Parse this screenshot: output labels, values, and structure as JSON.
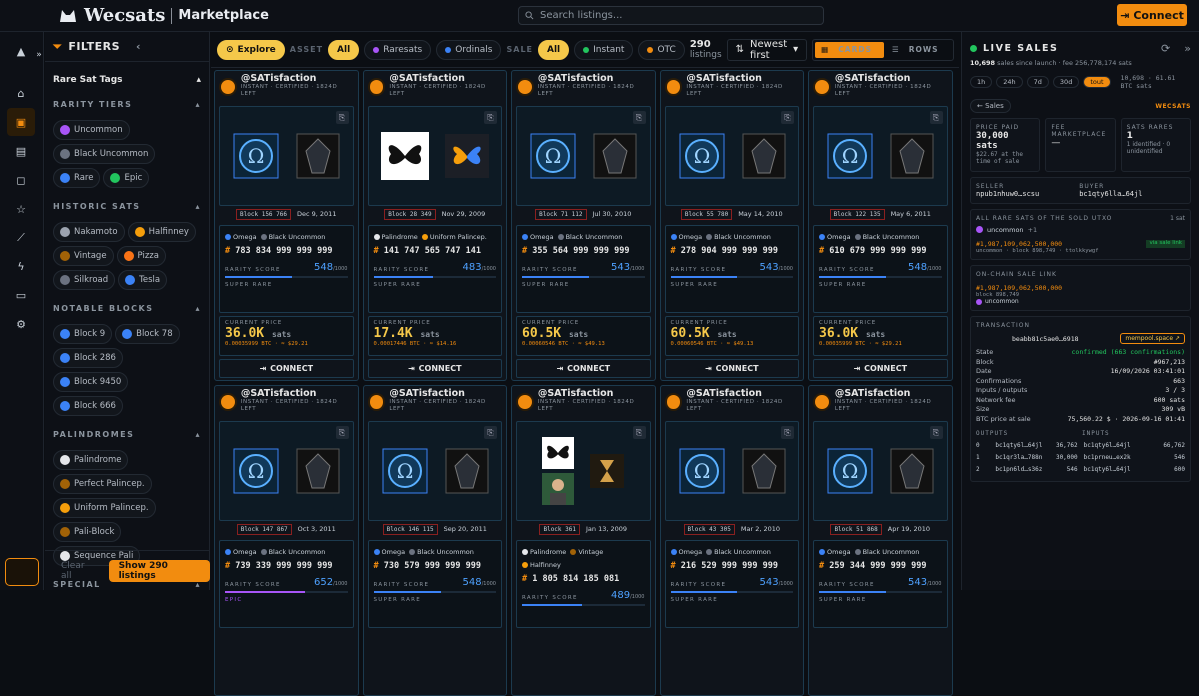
{
  "app": {
    "title": "Wecsats",
    "section": "Marketplace",
    "search_placeholder": "Search listings...",
    "connect_label": "Connect"
  },
  "filters": {
    "title": "FILTERS",
    "rare_sat_tags": "Rare Sat Tags",
    "sections": [
      {
        "title": "RARITY TIERS",
        "items": [
          {
            "label": "Uncommon",
            "color": "#a855f7"
          },
          {
            "label": "Black Uncommon",
            "color": "#6b7280"
          },
          {
            "label": "Rare",
            "color": "#3b82f6"
          },
          {
            "label": "Epic",
            "color": "#22c55e"
          }
        ]
      },
      {
        "title": "HISTORIC SATS",
        "items": [
          {
            "label": "Nakamoto",
            "color": "#9ca3af"
          },
          {
            "label": "Halfinney",
            "color": "#f59e0b"
          },
          {
            "label": "Vintage",
            "color": "#a16207"
          },
          {
            "label": "Pizza",
            "color": "#f97316"
          },
          {
            "label": "Silkroad",
            "color": "#6b7280"
          },
          {
            "label": "Tesla",
            "color": "#3b82f6"
          }
        ]
      },
      {
        "title": "NOTABLE BLOCKS",
        "items": [
          {
            "label": "Block 9",
            "color": "#3b82f6"
          },
          {
            "label": "Block 78",
            "color": "#3b82f6"
          },
          {
            "label": "Block 286",
            "color": "#3b82f6"
          },
          {
            "label": "Block 9450",
            "color": "#3b82f6"
          },
          {
            "label": "Block 666",
            "color": "#3b82f6"
          }
        ]
      },
      {
        "title": "PALINDROMES",
        "items": [
          {
            "label": "Palindrome",
            "color": "#e5e7eb"
          },
          {
            "label": "Perfect Palincep.",
            "color": "#a16207"
          },
          {
            "label": "Uniform Palincep.",
            "color": "#f59e0b"
          },
          {
            "label": "Pali-Block",
            "color": "#a16207"
          },
          {
            "label": "Sequence Pali",
            "color": "#e5e7eb"
          }
        ]
      },
      {
        "title": "SPECIAL",
        "items": []
      }
    ],
    "clear_label": "Clear all",
    "show_label": "Show 290 listings"
  },
  "toolbar": {
    "explore": "Explore",
    "asset_label": "ASSET",
    "asset_all": "All",
    "rarested": "Raresats",
    "ordinals": "Ordinals",
    "sale_label": "SALE",
    "sale_all": "All",
    "instant": "Instant",
    "otc": "OTC",
    "count": "290",
    "listings_word": "listings",
    "sort": "Newest first",
    "cards": "CARDS",
    "rows": "ROWS"
  },
  "cards": [
    {
      "user": "@SATisfaction",
      "sub": "INSTANT · CERTIFIED · 1824D LEFT",
      "block": "Block 156 766",
      "date": "Dec 9, 2011",
      "tags": [
        "Omega",
        "Black Uncommon"
      ],
      "sat": "783 834 999 999 999",
      "score": "548",
      "fill": 0.548,
      "tier": "SUPER RARE",
      "price": "36.0K",
      "btc": "0.00035999 BTC",
      "usd": "$29.21",
      "img": "omega"
    },
    {
      "user": "@SATisfaction",
      "sub": "INSTANT · CERTIFIED · 1824D LEFT",
      "block": "Block 28 349",
      "date": "Nov 29, 2009",
      "tags": [
        "Palindrome",
        "Uniform Palincep."
      ],
      "sat": "141 747 565 747 141",
      "score": "483",
      "fill": 0.483,
      "tier": "SUPER RARE",
      "price": "17.4K",
      "btc": "0.00017446 BTC",
      "usd": "$14.16",
      "img": "butterfly"
    },
    {
      "user": "@SATisfaction",
      "sub": "INSTANT · CERTIFIED · 1824D LEFT",
      "block": "Block 71 112",
      "date": "Jul 30, 2010",
      "tags": [
        "Omega",
        "Black Uncommon"
      ],
      "sat": "355 564 999 999 999",
      "score": "543",
      "fill": 0.543,
      "tier": "SUPER RARE",
      "price": "60.5K",
      "btc": "0.00060546 BTC",
      "usd": "$49.13",
      "img": "omega"
    },
    {
      "user": "@SATisfaction",
      "sub": "INSTANT · CERTIFIED · 1824D LEFT",
      "block": "Block 55 780",
      "date": "May 14, 2010",
      "tags": [
        "Omega",
        "Black Uncommon"
      ],
      "sat": "278 904 999 999 999",
      "score": "543",
      "fill": 0.543,
      "tier": "SUPER RARE",
      "price": "60.5K",
      "btc": "0.00060546 BTC",
      "usd": "$49.13",
      "img": "omega"
    },
    {
      "user": "@SATisfaction",
      "sub": "INSTANT · CERTIFIED · 1824D LEFT",
      "block": "Block 122 135",
      "date": "May 6, 2011",
      "tags": [
        "Omega",
        "Black Uncommon"
      ],
      "sat": "610 679 999 999 999",
      "score": "548",
      "fill": 0.548,
      "tier": "SUPER RARE",
      "price": "36.0K",
      "btc": "0.00035999 BTC",
      "usd": "$29.21",
      "img": "omega"
    },
    {
      "user": "@SATisfaction",
      "sub": "INSTANT · CERTIFIED · 1824D LEFT",
      "block": "Block 147 867",
      "date": "Oct 3, 2011",
      "tags": [
        "Omega",
        "Black Uncommon"
      ],
      "sat": "739 339 999 999 999",
      "score": "652",
      "fill": 0.652,
      "tier": "EPIC",
      "price": "",
      "btc": "",
      "usd": "",
      "img": "omega"
    },
    {
      "user": "@SATisfaction",
      "sub": "INSTANT · CERTIFIED · 1824D LEFT",
      "block": "Block 146 115",
      "date": "Sep 20, 2011",
      "tags": [
        "Omega",
        "Black Uncommon"
      ],
      "sat": "730 579 999 999 999",
      "score": "548",
      "fill": 0.548,
      "tier": "SUPER RARE",
      "price": "",
      "btc": "",
      "usd": "",
      "img": "omega"
    },
    {
      "user": "@SATisfaction",
      "sub": "INSTANT · CERTIFIED · 1824D LEFT",
      "block": "Block 361",
      "date": "Jan 13, 2009",
      "tags": [
        "Palindrome",
        "Vintage",
        "Halfinney"
      ],
      "sat": "1 805 814 185 081",
      "score": "489",
      "fill": 0.489,
      "tier": "",
      "price": "",
      "btc": "",
      "usd": "",
      "img": "butterfly2"
    },
    {
      "user": "@SATisfaction",
      "sub": "INSTANT · CERTIFIED · 1824D LEFT",
      "block": "Block 43 305",
      "date": "Mar 2, 2010",
      "tags": [
        "Omega",
        "Black Uncommon"
      ],
      "sat": "216 529 999 999 999",
      "score": "543",
      "fill": 0.543,
      "tier": "SUPER RARE",
      "price": "",
      "btc": "",
      "usd": "",
      "img": "omega"
    },
    {
      "user": "@SATisfaction",
      "sub": "INSTANT · CERTIFIED · 1824D LEFT",
      "block": "Block 51 868",
      "date": "Apr 19, 2010",
      "tags": [
        "Omega",
        "Black Uncommon"
      ],
      "sat": "259 344 999 999 999",
      "score": "543",
      "fill": 0.543,
      "tier": "SUPER RARE",
      "price": "",
      "btc": "",
      "usd": "",
      "img": "omega"
    }
  ],
  "card_labels": {
    "rarity": "RARITY SCORE",
    "max": "/1000",
    "current": "CURRENT PRICE",
    "sats": "sats",
    "connect": "CONNECT"
  },
  "right": {
    "title": "LIVE SALES",
    "count": "10,698",
    "since": "sales since launch",
    "fee": "fee 256,778,174 sats",
    "tf": [
      "1h",
      "24h",
      "7d",
      "30d",
      "tout"
    ],
    "tf_sel": "tout",
    "tf_sum": "10,698 · 61.61 BTC sats",
    "back": "← Sales",
    "wecsats": "WECSATS",
    "price_paid_l": "PRICE PAID",
    "price_paid": "30,000 sats",
    "price_usd": "$22.67 at the time of sale",
    "fee_l": "FEE MARKETPLACE",
    "fee_v": "—",
    "rares_l": "SATS RARES",
    "rares_v": "1",
    "rares_s": "1 identified · 0 unidentified",
    "seller_l": "SELLER",
    "seller": "npub1nhuw0…scsu",
    "buyer_l": "BUYER",
    "buyer": "bc1qty6lla…64jl",
    "all_rare": "ALL RARE SATS OF THE SOLD UTXO",
    "all_rare_n": "1 sat",
    "uncommon": "uncommon",
    "plus": "+1",
    "sat_id": "#1,987,109,062,500,000",
    "via": "via sale link",
    "sat_sub": "uncommon · block 898,749 · ttolkkywgf",
    "onchain": "ON-CHAIN SALE LINK",
    "oc_sat": "#1,987,109,062,500,000",
    "oc_block": "block 898,749",
    "oc_tag": "uncommon",
    "tx": "TRANSACTION",
    "txid": "beabb81c5ae0…6918",
    "mempool": "mempool.space ↗",
    "kv": [
      [
        "State",
        "confirmed (663 confirmations)"
      ],
      [
        "Block",
        "#967,213"
      ],
      [
        "Date",
        "16/09/2026 03:41:01"
      ],
      [
        "Confirmations",
        "663"
      ],
      [
        "Inputs / outputs",
        "3 / 3"
      ],
      [
        "Network fee",
        "600 sats"
      ],
      [
        "Size",
        "309 vB"
      ],
      [
        "BTC price at sale",
        "75,560.22 $ · 2026-09-16 01:41"
      ]
    ],
    "outputs_l": "OUTPUTS",
    "inputs_l": "INPUTS",
    "io": [
      [
        "0",
        "bc1qty6l…64jl",
        "36,762",
        "bc1qty6l…64jl",
        "66,762"
      ],
      [
        "1",
        "bc1qr3la…788n",
        "30,000",
        "bc1prneu…ex2k",
        "546"
      ],
      [
        "2",
        "bc1pn6ld…s36z",
        "546",
        "bc1qty6l…64jl",
        "600"
      ]
    ]
  }
}
